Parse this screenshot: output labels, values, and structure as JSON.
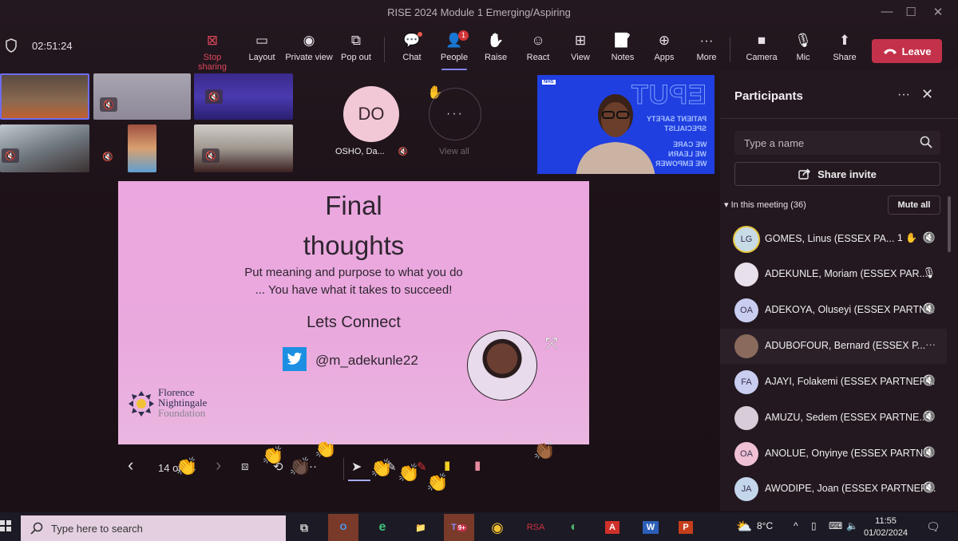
{
  "window": {
    "title": "RISE 2024 Module 1 Emerging/Aspiring",
    "minimize": "—",
    "maximize": "☐",
    "close": "✕"
  },
  "toolbar": {
    "timer": "02:51:24",
    "buttons": [
      {
        "id": "stop-sharing",
        "label": "Stop sharing",
        "icon": "⊠"
      },
      {
        "id": "layout",
        "label": "Layout",
        "icon": "▭"
      },
      {
        "id": "private-view",
        "label": "Private view",
        "icon": "◉"
      },
      {
        "id": "pop-out",
        "label": "Pop out",
        "icon": "⧉"
      },
      {
        "id": "chat",
        "label": "Chat",
        "icon": "💬"
      },
      {
        "id": "people",
        "label": "People",
        "icon": "👤",
        "badge": "1"
      },
      {
        "id": "raise",
        "label": "Raise",
        "icon": "✋"
      },
      {
        "id": "react",
        "label": "React",
        "icon": "☺"
      },
      {
        "id": "view",
        "label": "View",
        "icon": "⊞"
      },
      {
        "id": "notes",
        "label": "Notes",
        "icon": "📝"
      },
      {
        "id": "apps",
        "label": "Apps",
        "icon": "⊕"
      },
      {
        "id": "more",
        "label": "More",
        "icon": "···"
      },
      {
        "id": "camera",
        "label": "Camera",
        "icon": "■"
      },
      {
        "id": "mic",
        "label": "Mic",
        "icon": "🎙"
      },
      {
        "id": "share",
        "label": "Share",
        "icon": "⬆"
      }
    ],
    "leave_label": "Leave",
    "leave_color": "#c4314b"
  },
  "stage": {
    "featured_avatar": {
      "initials": "DO",
      "name": "OSHO, Da..."
    },
    "view_all": {
      "icon": "···",
      "label": "View all"
    },
    "eput_tile": {
      "logo": "NHS",
      "big_text": "EPUT",
      "tagline1": "PATIENT SAFETY",
      "tagline2": "SPECIALIST",
      "motto": [
        "WE CARE",
        "WE LEARN",
        "WE EMPOWER"
      ]
    }
  },
  "slide": {
    "title_line1": "Final",
    "title_line2": "thoughts",
    "line1": "Put meaning and purpose to what you do",
    "line2": "... You have what it takes to succeed!",
    "connect": "Lets Connect",
    "twitter_handle": "@m_adekunle22",
    "logo_lines": [
      "Florence",
      "Nightingale",
      "Foundation"
    ]
  },
  "slide_controls": {
    "page": "14 of 14",
    "prev": "‹",
    "next": "›",
    "more": "···"
  },
  "participants": {
    "title": "Participants",
    "more_icon": "···",
    "close_icon": "✕",
    "search_placeholder": "Type a name",
    "share_invite": "Share invite",
    "section_label": "In this meeting (36)",
    "mute_all": "Mute all",
    "list": [
      {
        "initials": "LG",
        "name": "GOMES, Linus (ESSEX PA...",
        "status": "mic-off",
        "hand_count": "1",
        "avatar_color": "#c8dce8"
      },
      {
        "initials": "",
        "name": "ADEKUNLE, Moriam (ESSEX PAR...",
        "status": "mic-on",
        "avatar_color": "#e8e0ea"
      },
      {
        "initials": "OA",
        "name": "ADEKOYA, Oluseyi (ESSEX PARTN...",
        "status": "mic-off",
        "avatar_color": "#c9cdf0"
      },
      {
        "initials": "",
        "name": "ADUBOFOUR, Bernard (ESSEX P...",
        "status": "more",
        "avatar_color": "#8a6a5c"
      },
      {
        "initials": "FA",
        "name": "AJAYI, Folakemi (ESSEX PARTNER...",
        "status": "mic-off",
        "avatar_color": "#c9cdf0"
      },
      {
        "initials": "",
        "name": "AMUZU, Sedem (ESSEX PARTNE...",
        "status": "mic-off",
        "avatar_color": "#d8ccd8"
      },
      {
        "initials": "OA",
        "name": "ANOLUE, Onyinye (ESSEX PARTN...",
        "status": "mic-off",
        "avatar_color": "#f0c0d4"
      },
      {
        "initials": "JA",
        "name": "AWODIPE, Joan (ESSEX PARTNER...",
        "status": "mic-off",
        "avatar_color": "#c4d6ea"
      }
    ]
  },
  "taskbar": {
    "search_placeholder": "Type here to search",
    "apps": [
      {
        "id": "task-view",
        "label": "⧉"
      },
      {
        "id": "outlook",
        "label": "O"
      },
      {
        "id": "edge",
        "label": "e"
      },
      {
        "id": "file-explorer",
        "label": "📁"
      },
      {
        "id": "teams",
        "label": "T",
        "badge": "9+"
      },
      {
        "id": "chrome",
        "label": "◉"
      },
      {
        "id": "rsa",
        "label": "RSA"
      },
      {
        "id": "citrix",
        "label": "◐"
      },
      {
        "id": "acrobat",
        "label": "A"
      },
      {
        "id": "word",
        "label": "W"
      },
      {
        "id": "powerpoint",
        "label": "P"
      }
    ],
    "weather": "8°C",
    "time": "11:55",
    "date": "01/02/2024"
  }
}
